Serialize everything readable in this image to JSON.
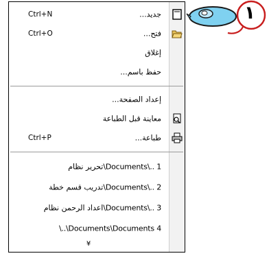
{
  "menu": {
    "items": [
      {
        "label": "جديد...",
        "shortcut": "Ctrl+N",
        "icon": "new-doc-icon"
      },
      {
        "label": "فتح...",
        "shortcut": "Ctrl+O",
        "icon": "open-folder-icon"
      },
      {
        "label": "إغلاق",
        "shortcut": "",
        "icon": ""
      },
      {
        "label": "حفظ باسم...",
        "shortcut": "",
        "icon": ""
      },
      {
        "label": "إعداد الصفحة...",
        "shortcut": "",
        "icon": ""
      },
      {
        "label": "معاينة قبل الطباعة",
        "shortcut": "",
        "icon": "print-preview-icon"
      },
      {
        "label": "طباعة...",
        "shortcut": "Ctrl+P",
        "icon": "printer-icon"
      },
      {
        "label": "1 ..\\Documents\\تحرير نظام",
        "shortcut": "",
        "icon": ""
      },
      {
        "label": "2 ..\\Documents\\تدريب قسم خطة",
        "shortcut": "",
        "icon": ""
      },
      {
        "label": "3 ..\\Documents\\اعداد الرحمن نظام",
        "shortcut": "",
        "icon": ""
      },
      {
        "label": "4 Documents\\Documents\\..\\",
        "shortcut": "",
        "icon": ""
      }
    ],
    "more_indicator": "¥"
  },
  "callout": {
    "number": "١",
    "image": "computer-mouse-icon"
  },
  "colors": {
    "mouse_body": "#7fd1f0",
    "mouse_outline": "#1a1a1a",
    "cable": "#c81e1e",
    "badge_circle": "#c81e1e"
  }
}
